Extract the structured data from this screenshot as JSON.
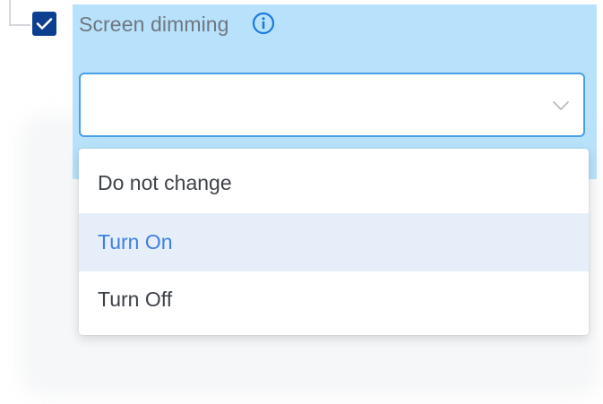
{
  "setting": {
    "label": "Screen dimming",
    "checked": true,
    "info_icon": "info-circle-icon"
  },
  "select": {
    "value": "",
    "chevron_icon": "chevron-down-icon"
  },
  "menu": {
    "options": [
      {
        "label": "Do not change",
        "highlighted": false
      },
      {
        "label": "Turn On",
        "highlighted": true
      },
      {
        "label": "Turn Off",
        "highlighted": false
      }
    ]
  },
  "colors": {
    "accent": "#3e7ee3",
    "checkbox": "#0d3f91",
    "panel": "#b8e2fb",
    "focus_border": "#4a9fe6",
    "highlight_bg": "#e6eefa"
  }
}
